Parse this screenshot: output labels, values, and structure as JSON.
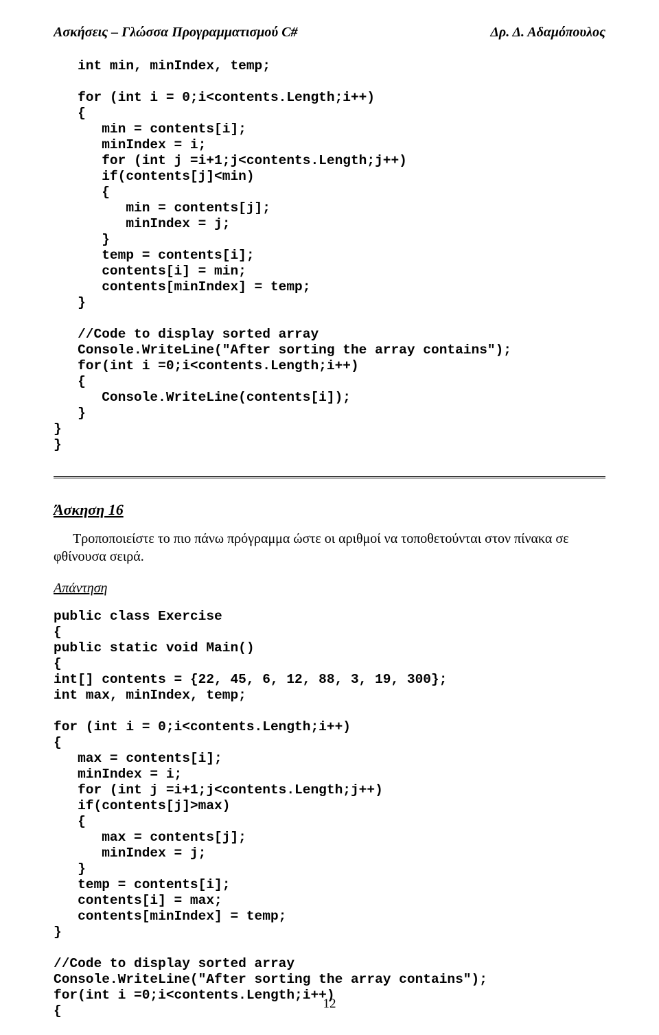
{
  "header": {
    "left": "Ασκήσεις – Γλώσσα Προγραμματισμού C#",
    "right": "Δρ. Δ. Αδαμόπουλος"
  },
  "codeTop": "   int min, minIndex, temp;\n\n   for (int i = 0;i<contents.Length;i++)\n   {\n      min = contents[i];\n      minIndex = i;\n      for (int j =i+1;j<contents.Length;j++)\n      if(contents[j]<min)\n      {\n         min = contents[j];\n         minIndex = j;\n      }\n      temp = contents[i];\n      contents[i] = min;\n      contents[minIndex] = temp;\n   }\n\n   //Code to display sorted array\n   Console.WriteLine(\"After sorting the array contains\");\n   for(int i =0;i<contents.Length;i++)\n   {\n      Console.WriteLine(contents[i]);\n   }\n}\n}",
  "exercise": {
    "title": "Άσκηση 16",
    "body": "Τροποποιείστε το πιο πάνω πρόγραμμα ώστε οι αριθμοί να τοποθετούνται στον πίνακα σε φθίνουσα σειρά.",
    "answerLabel": "Απάντηση"
  },
  "codeBottom": "public class Exercise\n{\npublic static void Main()\n{\nint[] contents = {22, 45, 6, 12, 88, 3, 19, 300};\nint max, minIndex, temp;\n\nfor (int i = 0;i<contents.Length;i++)\n{\n   max = contents[i];\n   minIndex = i;\n   for (int j =i+1;j<contents.Length;j++)\n   if(contents[j]>max)\n   {\n      max = contents[j];\n      minIndex = j;\n   }\n   temp = contents[i];\n   contents[i] = max;\n   contents[minIndex] = temp;\n}\n\n//Code to display sorted array\nConsole.WriteLine(\"After sorting the array contains\");\nfor(int i =0;i<contents.Length;i++)\n{",
  "pageNumber": "12"
}
